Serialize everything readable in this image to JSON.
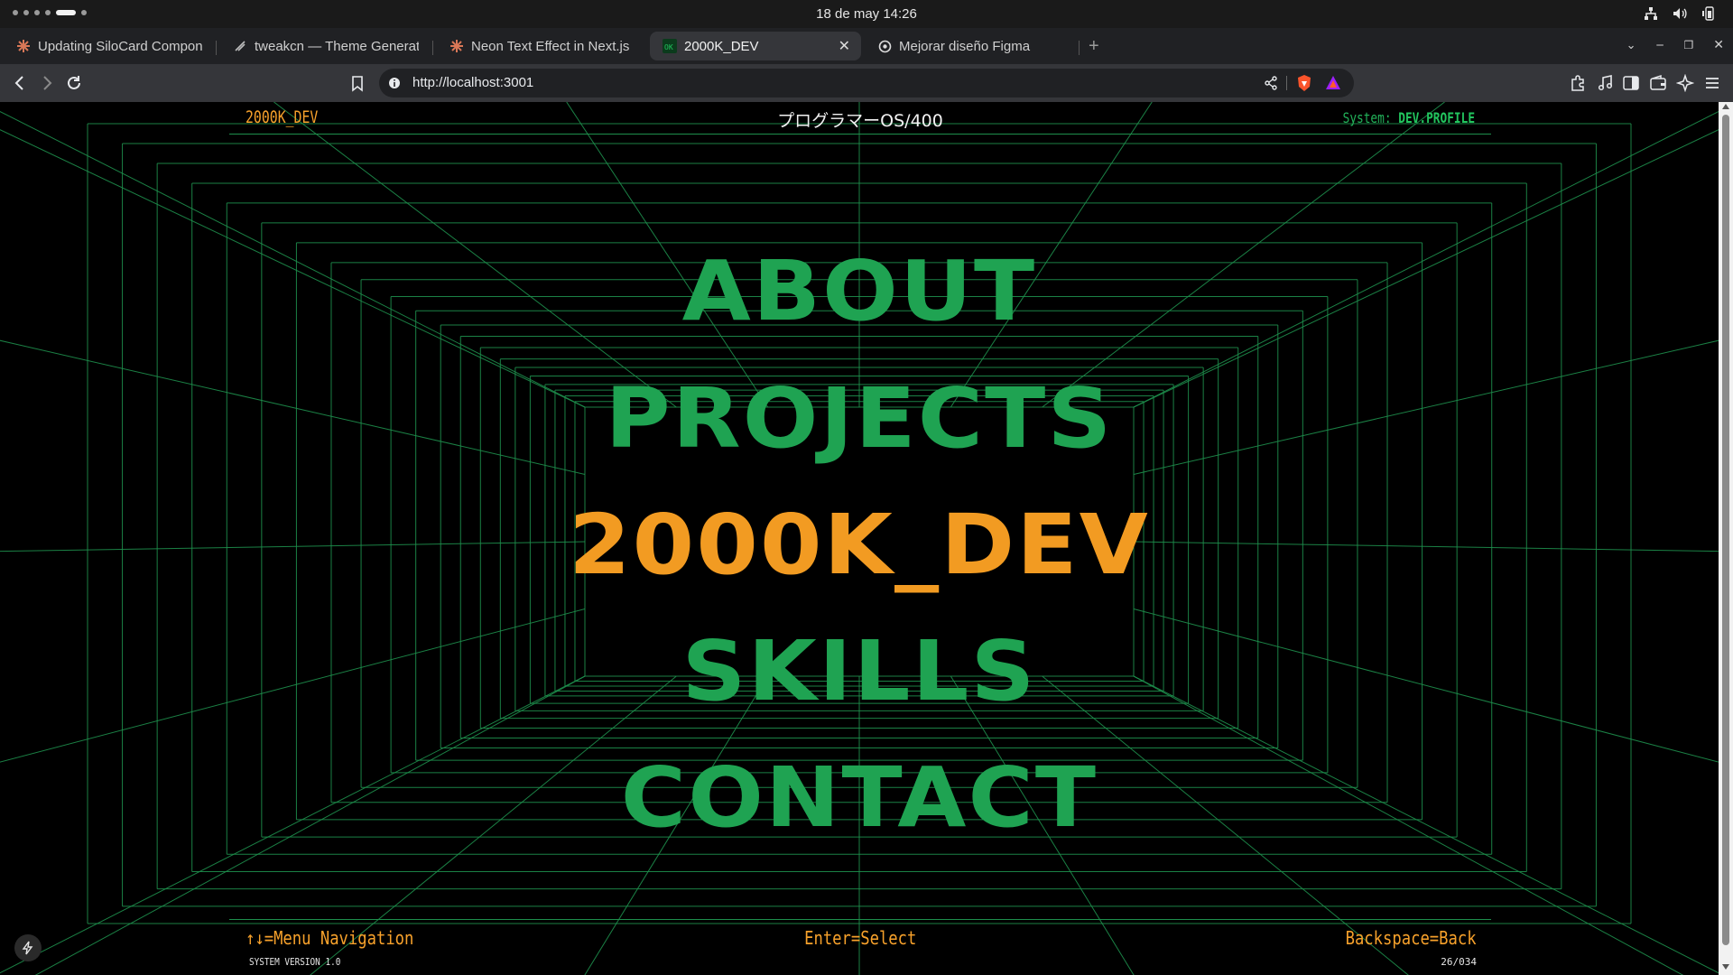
{
  "os": {
    "clock": "18 de may  14:26",
    "tray_icons": [
      "network-icon",
      "volume-icon",
      "battery-icon"
    ]
  },
  "browser": {
    "tabs": [
      {
        "title": "Updating SiloCard Compone",
        "icon": "claude-burst-icon",
        "active": false
      },
      {
        "title": "tweakcn — Theme Generato",
        "icon": "tweakcn-icon",
        "active": false
      },
      {
        "title": "Neon Text Effect in Next.js",
        "icon": "claude-burst-icon",
        "active": false
      },
      {
        "title": "2000K_DEV",
        "icon": "ok-terminal-icon",
        "active": true
      },
      {
        "title": "Mejorar diseño Figma",
        "icon": "openai-icon",
        "active": false
      }
    ],
    "new_tab_label": "+",
    "url": "http://localhost:3001"
  },
  "page": {
    "header": {
      "brand": "2000K_DEV",
      "title": "プログラマーOS/400",
      "system_label": "System:",
      "system_value": "DEV.PROFILE"
    },
    "menu": [
      {
        "label": "ABOUT",
        "selected": false
      },
      {
        "label": "PROJECTS",
        "selected": false
      },
      {
        "label": "2000K_DEV",
        "selected": true
      },
      {
        "label": "SKILLS",
        "selected": false
      },
      {
        "label": "CONTACT",
        "selected": false
      }
    ],
    "footer": {
      "nav_hint": "↑↓=Menu Navigation",
      "select_hint": "Enter=Select",
      "back_hint": "Backspace=Back",
      "version": "SYSTEM VERSION 1.0",
      "page_counter": "26/034"
    }
  },
  "colors": {
    "grid": "#1e8f4c",
    "menu": "#1fa352",
    "selected": "#f29b22",
    "accent": "#f7a12b"
  }
}
